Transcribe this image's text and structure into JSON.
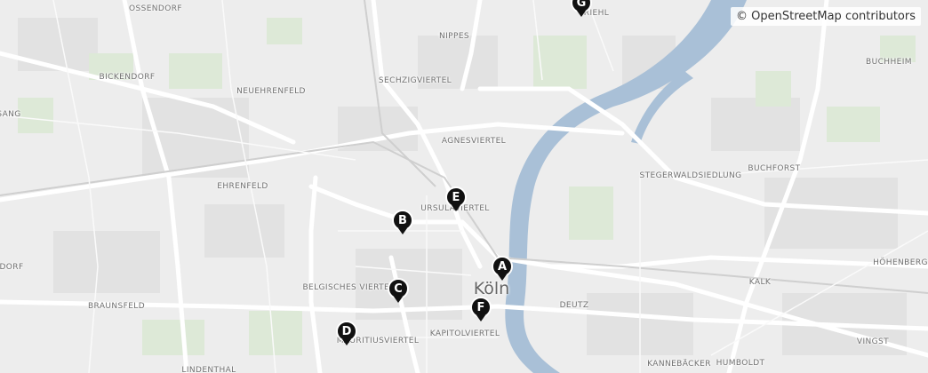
{
  "attribution": "© OpenStreetMap contributors",
  "city": "Köln",
  "districts": {
    "ossendorf": "OSSENDORF",
    "nippes": "NIPPES",
    "riehl": "RIEHL",
    "buchheim": "BUCHHEIM",
    "bickendorf": "BICKENDORF",
    "neuehrenfeld": "NEUEHRENFELD",
    "sechzigviertel": "SECHZIGVIERTEL",
    "sang": "SANG",
    "agnesviertel": "AGNESVIERTEL",
    "stegerwaldsiedlung": "STEGERWALDSIEDLUNG",
    "buchforst": "BUCHFORST",
    "ehrenfeld": "EHRENFELD",
    "ursulaviertel": "URSULAVIERTEL",
    "dorf": "DORF",
    "hoehenberg": "HÖHENBERG",
    "belgisches": "BELGISCHES VIERTEL",
    "kalk": "KALK",
    "braunsfeld": "BRAUNSFELD",
    "deutz": "DEUTZ",
    "kapitol": "KAPITOLVIERTEL",
    "mauritius": "MAURITIUSVIERTEL",
    "vingst": "VINGST",
    "lindenthal": "LINDENTHAL",
    "kannebaecker": "KANNEBÄCKER",
    "humboldt": "HUMBOLDT"
  },
  "markers": [
    {
      "label": "A"
    },
    {
      "label": "B"
    },
    {
      "label": "C"
    },
    {
      "label": "D"
    },
    {
      "label": "E"
    },
    {
      "label": "F"
    },
    {
      "label": "G"
    }
  ]
}
